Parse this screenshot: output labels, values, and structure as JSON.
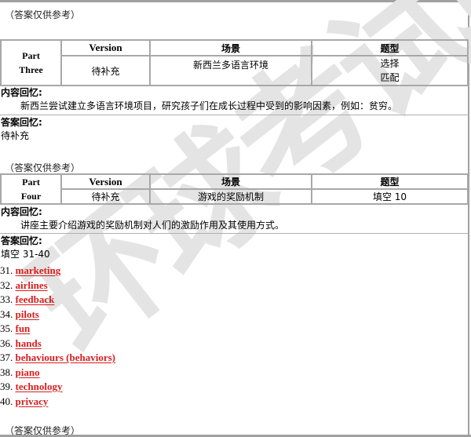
{
  "watermark": {
    "text": "环球考试院",
    "color": "#e4e4e4"
  },
  "note_label": "（答案仅供参考）",
  "table_headers": {
    "part": "Part",
    "version": "Version",
    "scene": "场景",
    "type": "题型"
  },
  "part_three": {
    "part_line1": "Part",
    "part_line2": "Three",
    "version": "待补充",
    "scene": "新西兰多语言环境",
    "type_line1": "选择",
    "type_line2": "匹配",
    "content_label": "内容回忆:",
    "content_text": "新西兰尝试建立多语言环境项目，研究孩子们在成长过程中受到的影响因素，例如：贫穷。",
    "answer_label": "答案回忆:",
    "answer_text": "待补充"
  },
  "part_four": {
    "part_line1": "Part",
    "part_line2": "Four",
    "version": "待补充",
    "scene": "游戏的奖励机制",
    "type": "填空 10",
    "content_label": "内容回忆:",
    "content_text": "讲座主要介绍游戏的奖励机制对人们的激励作用及其使用方式。",
    "answer_label": "答案回忆:",
    "answer_range": "填空 31-40",
    "answers": [
      {
        "num": "31.",
        "word": "marketing"
      },
      {
        "num": "32.",
        "word": "airlines"
      },
      {
        "num": "33.",
        "word": "feedback"
      },
      {
        "num": "34.",
        "word": "pilots"
      },
      {
        "num": "35.",
        "word": "fun"
      },
      {
        "num": "36.",
        "word": "hands"
      },
      {
        "num": "37.",
        "word": "behaviours (behaviors)"
      },
      {
        "num": "38.",
        "word": "piano"
      },
      {
        "num": "39.",
        "word": "technology"
      },
      {
        "num": "40.",
        "word": "privacy"
      }
    ]
  },
  "colors": {
    "answer_red": "#d81e1e",
    "border_gray": "#a8a8a8"
  }
}
